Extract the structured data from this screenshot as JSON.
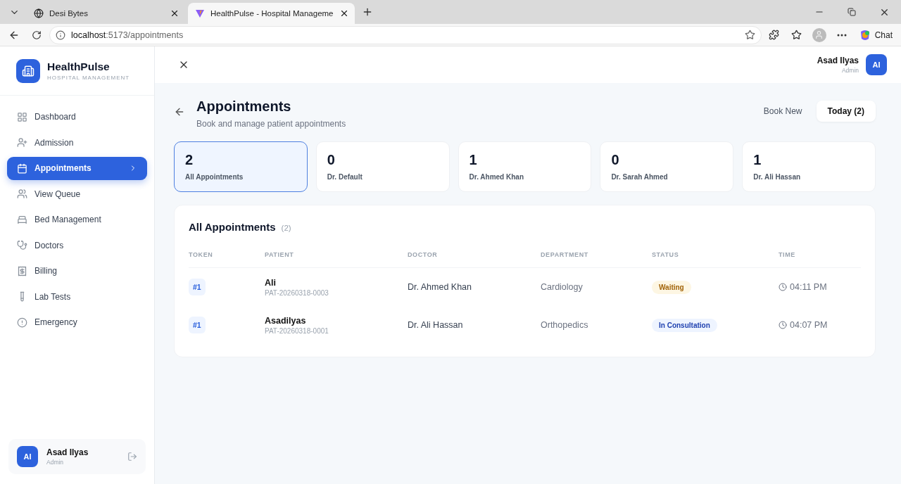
{
  "browser": {
    "tabs": [
      {
        "title": "Desi Bytes",
        "selected": false
      },
      {
        "title": "HealthPulse - Hospital Manageme",
        "selected": true
      }
    ],
    "url_host": "localhost",
    "url_rest": ":5173/appointments",
    "chat": "Chat"
  },
  "sidebar": {
    "brand": "HealthPulse",
    "subtitle": "HOSPITAL MANAGEMENT",
    "items": [
      {
        "label": "Dashboard",
        "selected": false
      },
      {
        "label": "Admission",
        "selected": false
      },
      {
        "label": "Appointments",
        "selected": true
      },
      {
        "label": "View Queue",
        "selected": false
      },
      {
        "label": "Bed Management",
        "selected": false
      },
      {
        "label": "Doctors",
        "selected": false
      },
      {
        "label": "Billing",
        "selected": false
      },
      {
        "label": "Lab Tests",
        "selected": false
      },
      {
        "label": "Emergency",
        "selected": false
      }
    ],
    "user": {
      "initials": "AI",
      "name": "Asad Ilyas",
      "role": "Admin"
    }
  },
  "header": {
    "user": {
      "initials": "AI",
      "name": "Asad Ilyas",
      "role": "Admin"
    }
  },
  "page": {
    "title": "Appointments",
    "subtitle": "Book and manage patient appointments",
    "actions": [
      {
        "label": "Book New",
        "selected": false
      },
      {
        "label": "Today (2)",
        "selected": true
      }
    ],
    "stats": [
      {
        "count": "2",
        "label": "All Appointments",
        "selected": true
      },
      {
        "count": "0",
        "label": "Dr. Default",
        "selected": false
      },
      {
        "count": "1",
        "label": "Dr. Ahmed Khan",
        "selected": false
      },
      {
        "count": "0",
        "label": "Dr. Sarah Ahmed",
        "selected": false
      },
      {
        "count": "1",
        "label": "Dr. Ali Hassan",
        "selected": false
      }
    ]
  },
  "table": {
    "title": "All Appointments",
    "count": "(2)",
    "columns": [
      "TOKEN",
      "PATIENT",
      "DOCTOR",
      "DEPARTMENT",
      "STATUS",
      "TIME"
    ],
    "rows": [
      {
        "token": "#1",
        "patient": "Ali",
        "patient_id": "PAT-20260318-0003",
        "doctor": "Dr. Ahmed Khan",
        "department": "Cardiology",
        "status": "Waiting",
        "kind": "waiting",
        "time": "04:11 PM"
      },
      {
        "token": "#1",
        "patient": "Asadilyas",
        "patient_id": "PAT-20260318-0001",
        "doctor": "Dr. Ali Hassan",
        "department": "Orthopedics",
        "status": "In Consultation",
        "kind": "consultation",
        "time": "04:07 PM"
      }
    ]
  }
}
